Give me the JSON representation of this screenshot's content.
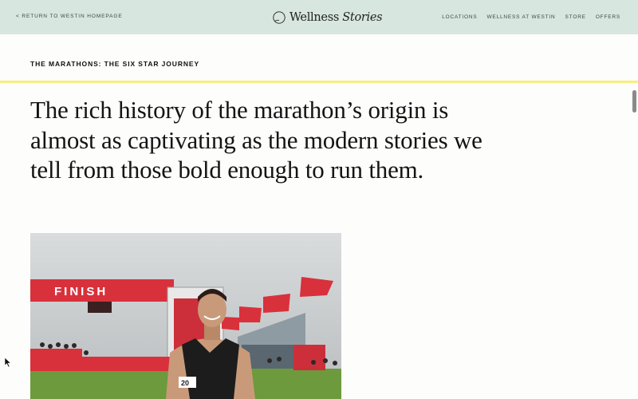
{
  "header": {
    "back_link": "< RETURN TO WESTIN HOMEPAGE",
    "logo_word": "Wellness",
    "logo_italic": "Stories",
    "nav": [
      "LOCATIONS",
      "WELLNESS AT WESTIN",
      "STORE",
      "OFFERS"
    ]
  },
  "article": {
    "section_label": "THE MARATHONS: THE SIX STAR JOURNEY",
    "headline": "The rich history of the marathon’s origin is almost as captivating as the modern stories we tell from those bold enough to run them."
  },
  "photo": {
    "finish_banner": "FINISH",
    "bib_number": "20"
  },
  "colors": {
    "header_bg": "#d7e6df",
    "accent_rule": "#f5f07c",
    "finish_red": "#d8313c"
  }
}
